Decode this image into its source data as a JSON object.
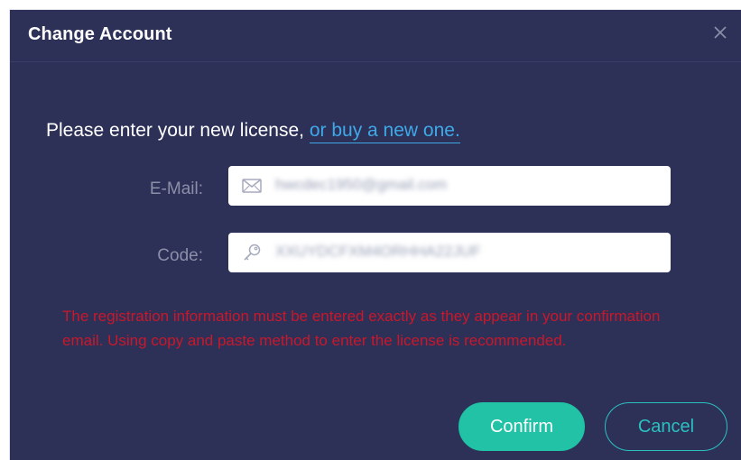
{
  "dialog": {
    "title": "Change Account",
    "close_icon": "close-icon"
  },
  "prompt": {
    "text": "Please enter your new license, ",
    "link": "or buy a new one."
  },
  "form": {
    "email": {
      "label": "E-Mail:",
      "icon": "mail-icon",
      "value": "hwcdec1950@gmail.com"
    },
    "code": {
      "label": "Code:",
      "icon": "key-icon",
      "value": "XXUYDCFXM4ORHHA22JUF"
    }
  },
  "warning": "The registration information must be entered exactly as they appear in your confirmation email. Using copy and paste method to enter the license is recommended.",
  "buttons": {
    "confirm": "Confirm",
    "cancel": "Cancel"
  },
  "colors": {
    "background": "#2d3057",
    "accent": "#21c2a6",
    "link": "#3fa9e8",
    "error": "#c9182b"
  }
}
